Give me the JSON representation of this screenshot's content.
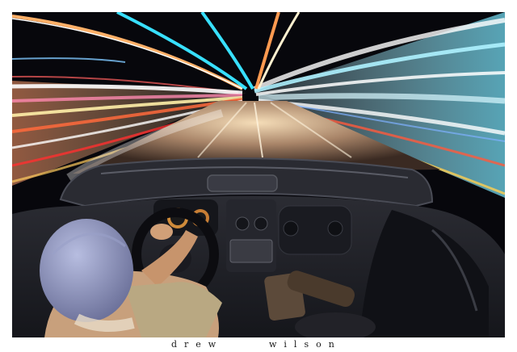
{
  "photo": {
    "subject": "night-drive-long-exposure",
    "colors": {
      "sky": "#07070c",
      "road": "#6b5848",
      "cyan_streak": "#38e0ff",
      "orange_streak": "#ff8a3c",
      "white_streak": "#fff6e8",
      "car_interior": "#1d1e24",
      "cap": "#8a8fb8"
    }
  },
  "caption": {
    "first_name": "drew",
    "last_name": "wilson"
  }
}
